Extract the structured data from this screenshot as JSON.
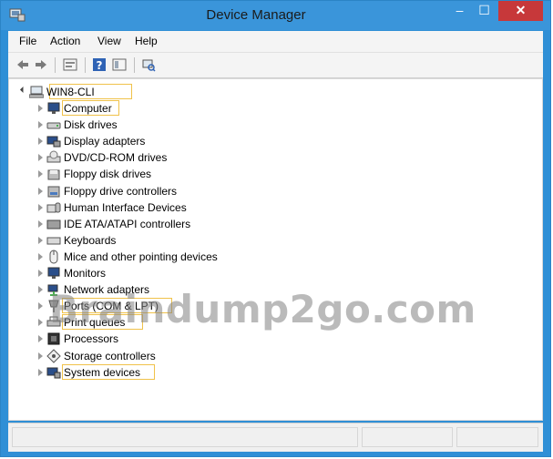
{
  "window": {
    "title": "Device Manager",
    "close_symbol": "✕",
    "minimize_symbol": "–",
    "maximize_symbol": "☐",
    "icon": "device-manager-icon"
  },
  "menu": {
    "items": [
      "File",
      "Action",
      "View",
      "Help"
    ]
  },
  "toolbar": {
    "buttons": [
      "back-arrow-icon",
      "forward-arrow-icon",
      "properties-icon",
      "help-icon",
      "show-hide-icon",
      "scan-hardware-icon"
    ]
  },
  "tree": {
    "root": {
      "label": "WIN8-CLI",
      "icon": "computer-icon",
      "expanded": true,
      "highlighted": true
    },
    "items": [
      {
        "label": "Computer",
        "icon": "monitor-icon",
        "highlighted": true
      },
      {
        "label": "Disk drives",
        "icon": "disk-drive-icon",
        "highlighted": false
      },
      {
        "label": "Display adapters",
        "icon": "display-adapter-icon",
        "highlighted": false
      },
      {
        "label": "DVD/CD-ROM drives",
        "icon": "dvd-drive-icon",
        "highlighted": false
      },
      {
        "label": "Floppy disk drives",
        "icon": "floppy-disk-icon",
        "highlighted": false
      },
      {
        "label": "Floppy drive controllers",
        "icon": "floppy-controller-icon",
        "highlighted": false
      },
      {
        "label": "Human Interface Devices",
        "icon": "hid-icon",
        "highlighted": false
      },
      {
        "label": "IDE ATA/ATAPI controllers",
        "icon": "ide-controller-icon",
        "highlighted": false
      },
      {
        "label": "Keyboards",
        "icon": "keyboard-icon",
        "highlighted": false
      },
      {
        "label": "Mice and other pointing devices",
        "icon": "mouse-icon",
        "highlighted": false
      },
      {
        "label": "Monitors",
        "icon": "monitor-icon",
        "highlighted": false
      },
      {
        "label": "Network adapters",
        "icon": "network-adapter-icon",
        "highlighted": false
      },
      {
        "label": "Ports (COM & LPT)",
        "icon": "port-icon",
        "highlighted": true
      },
      {
        "label": "Print queues",
        "icon": "printer-icon",
        "highlighted": true
      },
      {
        "label": "Processors",
        "icon": "processor-icon",
        "highlighted": false
      },
      {
        "label": "Storage controllers",
        "icon": "storage-controller-icon",
        "highlighted": false
      },
      {
        "label": "System devices",
        "icon": "system-devices-icon",
        "highlighted": true
      }
    ]
  },
  "watermark": {
    "text": "Braindump2go.com"
  },
  "colors": {
    "titlebar": "#3a95da",
    "close_button": "#c7383a",
    "highlight_border": "#f0c24a",
    "chrome": "#f4f4f4"
  }
}
